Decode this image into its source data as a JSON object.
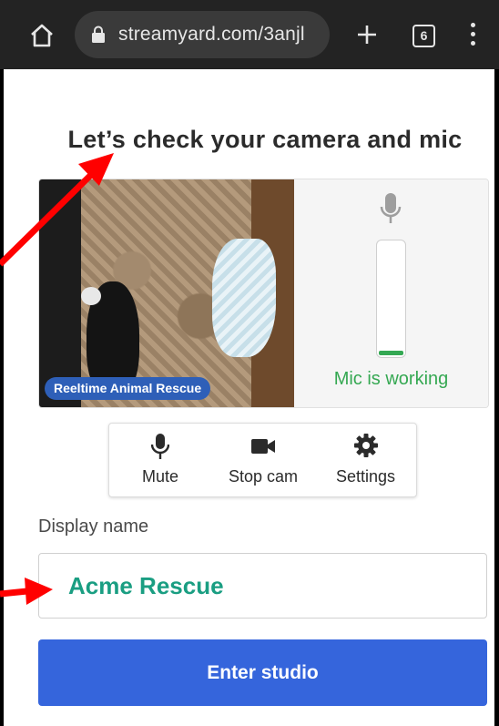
{
  "browser": {
    "url": "streamyard.com/3anjl",
    "tab_count": "6"
  },
  "page": {
    "title": "Let’s check your camera and mic"
  },
  "preview": {
    "name_tag": "Reeltime Animal Rescue",
    "mic_status": "Mic is working",
    "mic_level": 0.04
  },
  "controls": [
    {
      "label": "Mute",
      "icon": "mic-icon"
    },
    {
      "label": "Stop cam",
      "icon": "video-camera-icon"
    },
    {
      "label": "Settings",
      "icon": "gear-icon"
    }
  ],
  "display_name": {
    "label": "Display name",
    "value": "Acme Rescue"
  },
  "enter_button": {
    "label": "Enter studio"
  },
  "colors": {
    "accent": "#3565dc",
    "mic_ok": "#35a852",
    "display_value": "#1a9e82",
    "annotation_arrow": "#ff0000"
  }
}
